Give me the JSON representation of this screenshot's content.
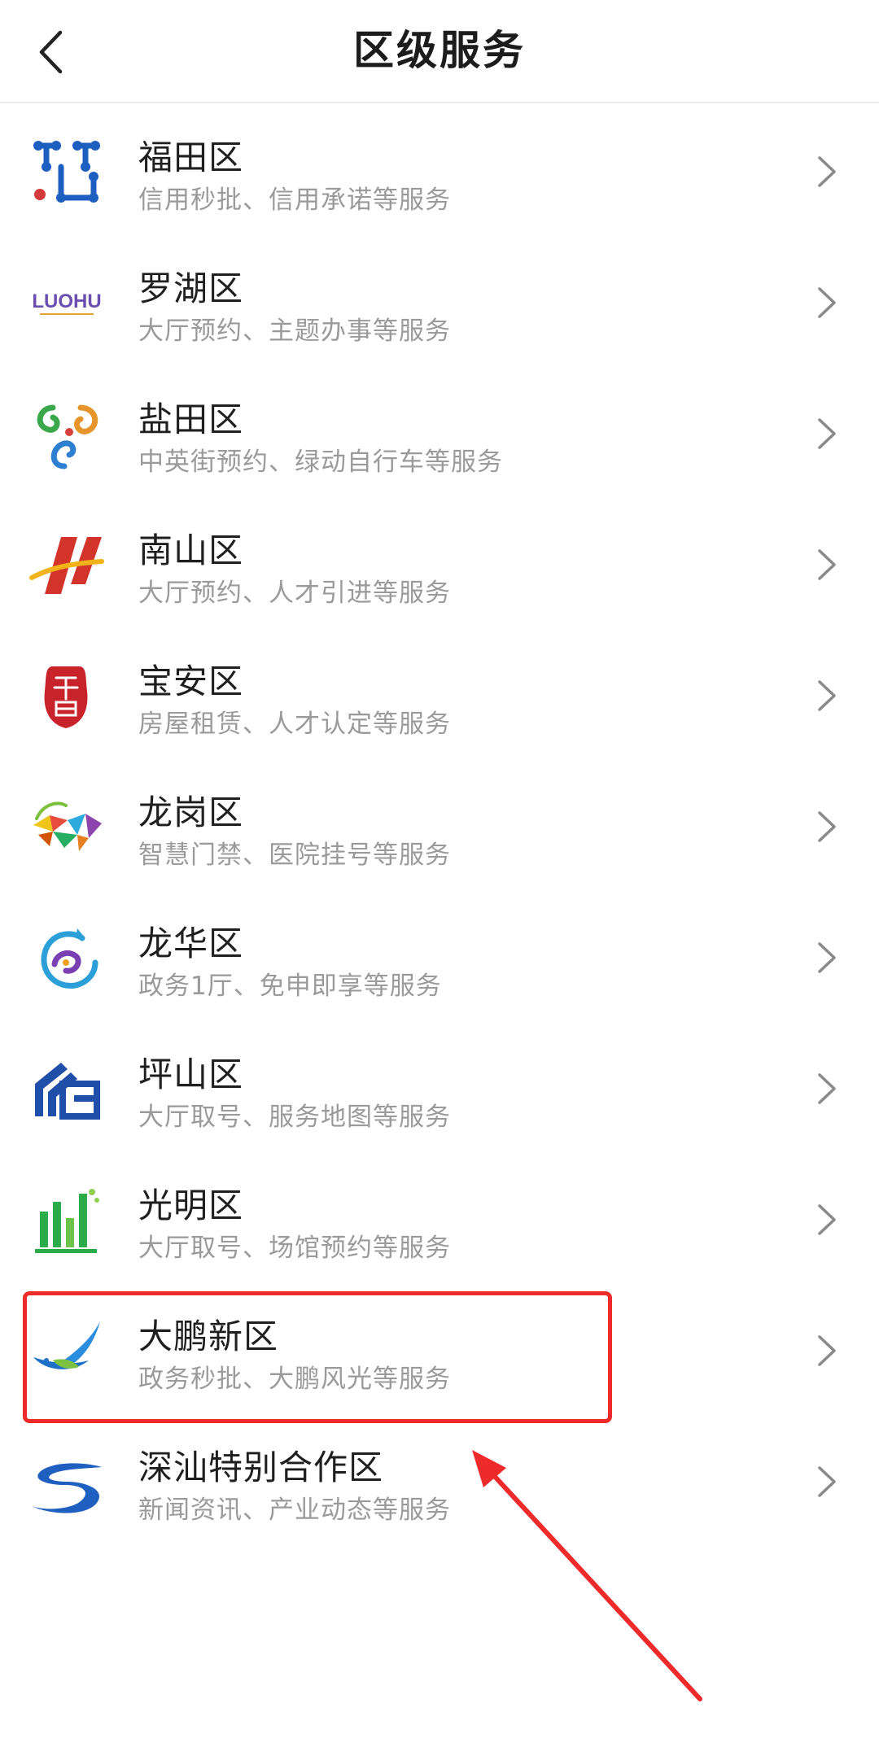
{
  "header": {
    "title": "区级服务",
    "back_icon": "chevron-left-icon"
  },
  "districts": [
    {
      "name": "福田区",
      "desc": "信用秒批、信用承诺等服务",
      "logo": "futian-logo"
    },
    {
      "name": "罗湖区",
      "desc": "大厅预约、主题办事等服务",
      "logo": "luohu-logo",
      "logo_text": "LUOHU"
    },
    {
      "name": "盐田区",
      "desc": "中英街预约、绿动自行车等服务",
      "logo": "yantian-logo"
    },
    {
      "name": "南山区",
      "desc": "大厅预约、人才引进等服务",
      "logo": "nanshan-logo"
    },
    {
      "name": "宝安区",
      "desc": "房屋租赁、人才认定等服务",
      "logo": "baoan-logo"
    },
    {
      "name": "龙岗区",
      "desc": "智慧门禁、医院挂号等服务",
      "logo": "longgang-logo"
    },
    {
      "name": "龙华区",
      "desc": "政务1厅、免申即享等服务",
      "logo": "longhua-logo"
    },
    {
      "name": "坪山区",
      "desc": "大厅取号、服务地图等服务",
      "logo": "pingshan-logo"
    },
    {
      "name": "光明区",
      "desc": "大厅取号、场馆预约等服务",
      "logo": "guangming-logo"
    },
    {
      "name": "大鹏新区",
      "desc": "政务秒批、大鹏风光等服务",
      "logo": "dapeng-logo"
    },
    {
      "name": "深汕特别合作区",
      "desc": "新闻资讯、产业动态等服务",
      "logo": "shenshan-logo"
    }
  ],
  "row_chevron_icon": "chevron-right-icon",
  "annotation": {
    "highlighted_item": "大鹏新区",
    "color": "#ee2a2a"
  }
}
